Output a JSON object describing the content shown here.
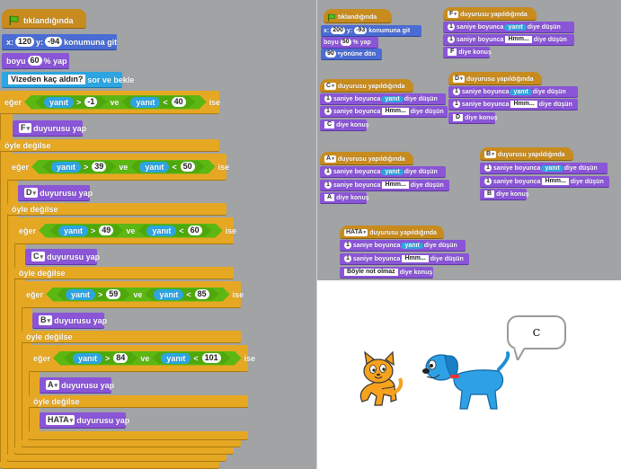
{
  "script_left": {
    "when_flag": "tıklandığında",
    "goto": {
      "x_label": "x:",
      "x": "120",
      "y_label": "y:",
      "y": "-94",
      "suffix": "konumuna git"
    },
    "size": {
      "prefix": "boyu",
      "value": "60",
      "suffix": "% yap"
    },
    "ask": {
      "question": "Vizeden kaç aldın?",
      "suffix": "sor ve bekle"
    },
    "if_label": "eğer",
    "then_label": "ise",
    "else_label": "öyle değilse",
    "and_label": "ve",
    "answer_label": "yanıt",
    "broadcast_suffix": "duyurusu yap",
    "cond1": {
      "a": "-1",
      "b": "40"
    },
    "bc1": "F",
    "cond2": {
      "a": "39",
      "b": "50"
    },
    "bc2": "D",
    "cond3": {
      "a": "49",
      "b": "60"
    },
    "bc3": "C",
    "cond4": {
      "a": "59",
      "b": "85"
    },
    "bc4": "B",
    "cond5": {
      "a": "84",
      "b": "101"
    },
    "bc5": "A",
    "bc6": "HATA"
  },
  "script_right": {
    "when_flag": "tıklandığında",
    "goto": {
      "x_label": "x:",
      "x": "200",
      "y_label": "y:",
      "y": "-93",
      "suffix": "konumuna git"
    },
    "size": {
      "prefix": "boyu",
      "value": "50",
      "suffix": "% yap"
    },
    "turn": {
      "value": "90",
      "suffix": "yönüne dön"
    },
    "receive_suffix": "duyurusu yapıldığında",
    "think_prefix": "saniye boyunca",
    "think_suffix": "diye düşün",
    "answer_label": "yanıt",
    "hmm": "Hmm...",
    "say_suffix": "diye konuş",
    "secs": "1",
    "hats": [
      {
        "msg": "F",
        "say": "F"
      },
      {
        "msg": "C",
        "say": "C"
      },
      {
        "msg": "D",
        "say": "D"
      },
      {
        "msg": "A",
        "say": "A"
      },
      {
        "msg": "B",
        "say": "B"
      },
      {
        "msg": "HATA",
        "say": "Böyle not olmaz"
      }
    ]
  },
  "stage": {
    "speech_bubble": "C"
  },
  "colors": {
    "events": "#c88b1d",
    "motion": "#4a6cd4",
    "looks": "#8a55d7",
    "sensing": "#2ca5e2",
    "control": "#e6a823",
    "operators": "#5cb712"
  }
}
